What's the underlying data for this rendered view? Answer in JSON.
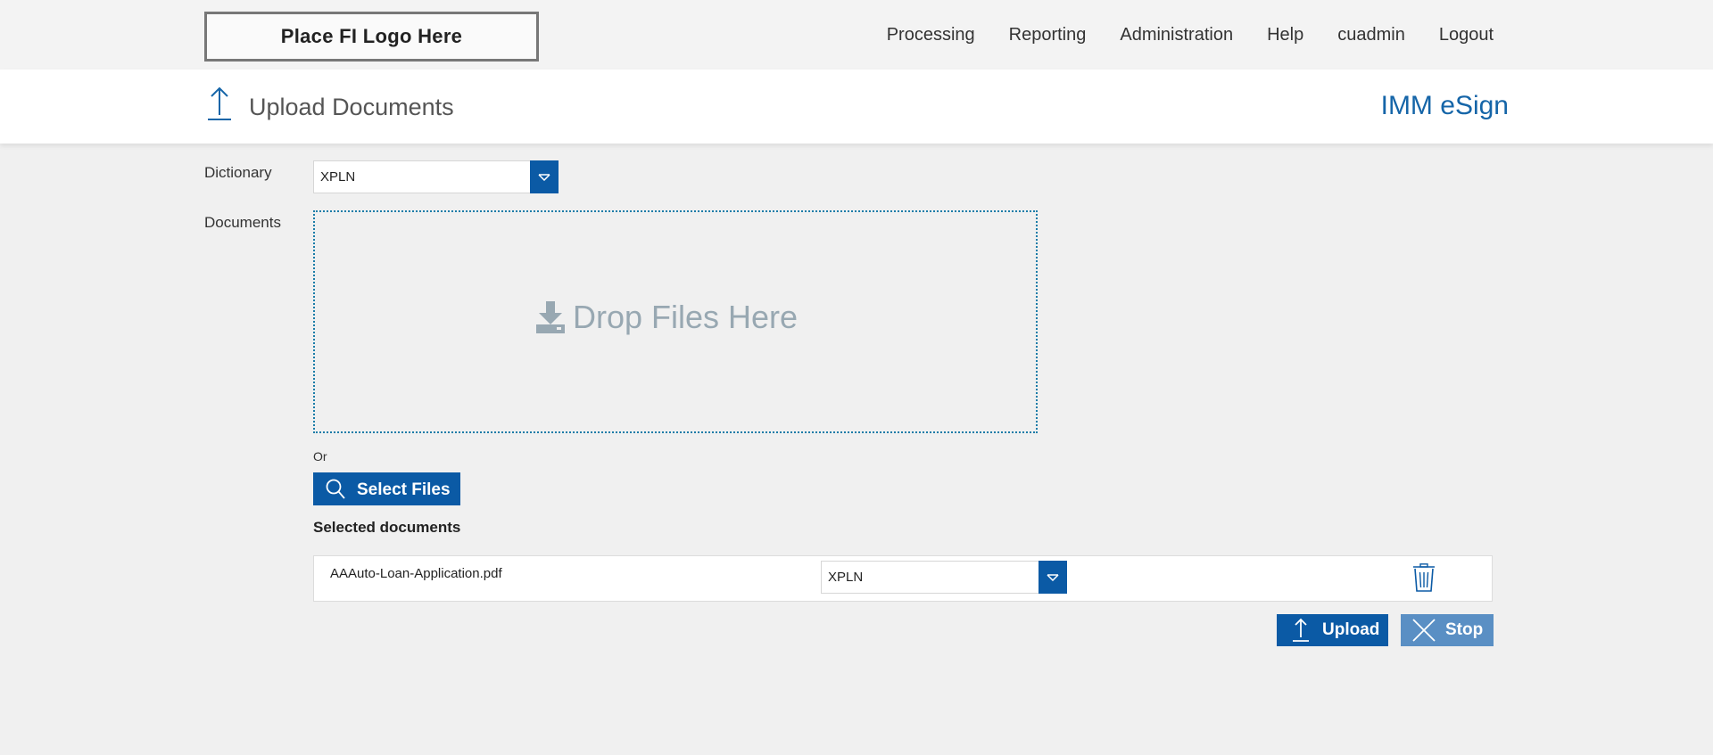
{
  "header": {
    "logo_text": "Place FI Logo Here",
    "nav": [
      "Processing",
      "Reporting",
      "Administration",
      "Help",
      "cuadmin",
      "Logout"
    ]
  },
  "page": {
    "title": "Upload Documents",
    "title_icon": "upload-arrow-icon",
    "brand": "IMM eSign"
  },
  "form": {
    "dictionary_label": "Dictionary",
    "dictionary_value": "XPLN",
    "documents_label": "Documents",
    "dropzone_text": "Drop Files Here",
    "dropzone_icon": "download-tray-icon",
    "or_text": "Or",
    "select_files_label": "Select Files",
    "select_files_icon": "search-icon"
  },
  "selected": {
    "heading": "Selected documents",
    "rows": [
      {
        "file_name": "AAAuto-Loan-Application.pdf",
        "dictionary": "XPLN",
        "delete_icon": "trash-icon"
      }
    ]
  },
  "actions": {
    "upload_label": "Upload",
    "upload_icon": "upload-arrow-icon",
    "stop_label": "Stop",
    "stop_icon": "close-icon"
  },
  "colors": {
    "primary": "#0b5aa5",
    "primary_disabled": "#5a8fc4",
    "brand_text": "#1565a8",
    "dropzone_border": "#1a7ca8",
    "dropzone_text": "#98a8b2",
    "background": "#f0f0f0"
  }
}
